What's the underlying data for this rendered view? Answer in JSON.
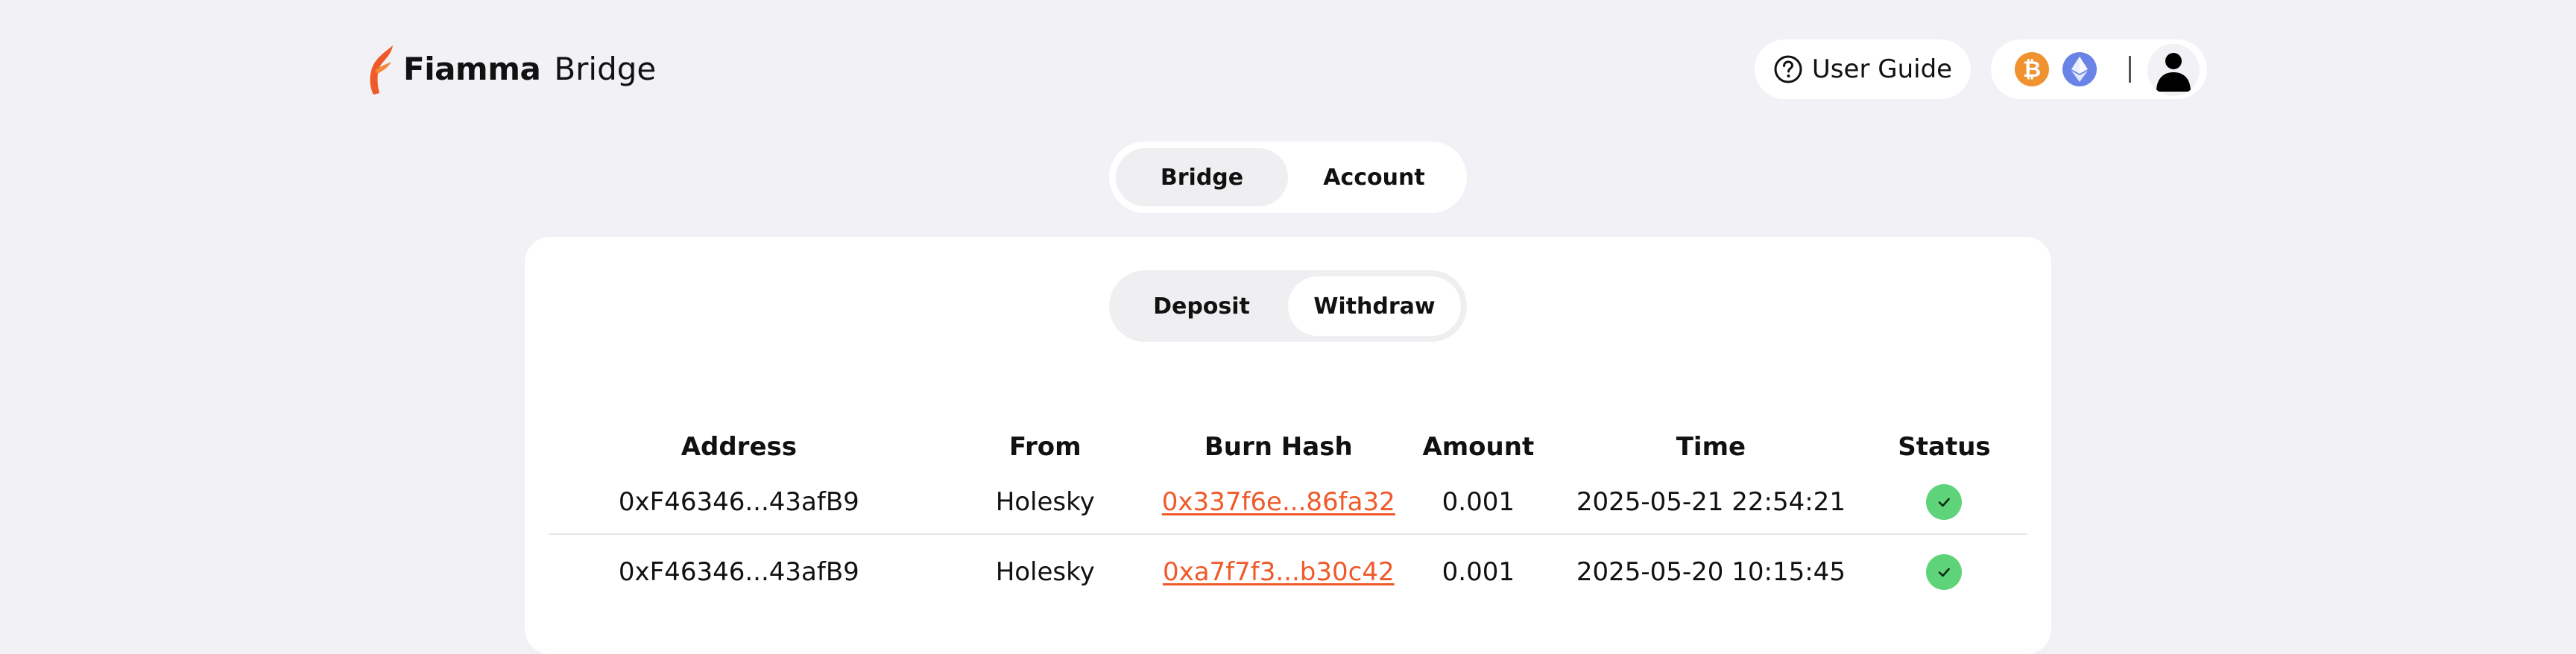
{
  "brand": {
    "name": "Fiamma",
    "sub": "Bridge",
    "icon": "flame-logo-icon",
    "accent": "#ef5a2a"
  },
  "header": {
    "user_guide_label": "User Guide",
    "user_guide_icon": "question-circle-icon",
    "wallet": {
      "btc_symbol": "₿",
      "btc_icon": "bitcoin-icon",
      "eth_icon": "ethereum-icon",
      "avatar_icon": "user-avatar-icon",
      "btc_color": "#f0922f",
      "eth_color": "#6a83e6"
    }
  },
  "top_tabs": [
    {
      "label": "Bridge",
      "active": true
    },
    {
      "label": "Account",
      "active": false
    }
  ],
  "sub_tabs": [
    {
      "label": "Deposit",
      "active": false
    },
    {
      "label": "Withdraw",
      "active": true
    }
  ],
  "table": {
    "columns": [
      "Address",
      "From",
      "Burn Hash",
      "Amount",
      "Time",
      "Status"
    ],
    "rows": [
      {
        "address": "0xF46346...43afB9",
        "from": "Holesky",
        "burn_hash": "0x337f6e...86fa32",
        "amount": "0.001",
        "time": "2025-05-21 22:54:21",
        "status": "success"
      },
      {
        "address": "0xF46346...43afB9",
        "from": "Holesky",
        "burn_hash": "0xa7f7f3...b30c42",
        "amount": "0.001",
        "time": "2025-05-20 10:15:45",
        "status": "success"
      }
    ],
    "status_color": "#5fd37a",
    "link_color": "#ef5a2a"
  }
}
